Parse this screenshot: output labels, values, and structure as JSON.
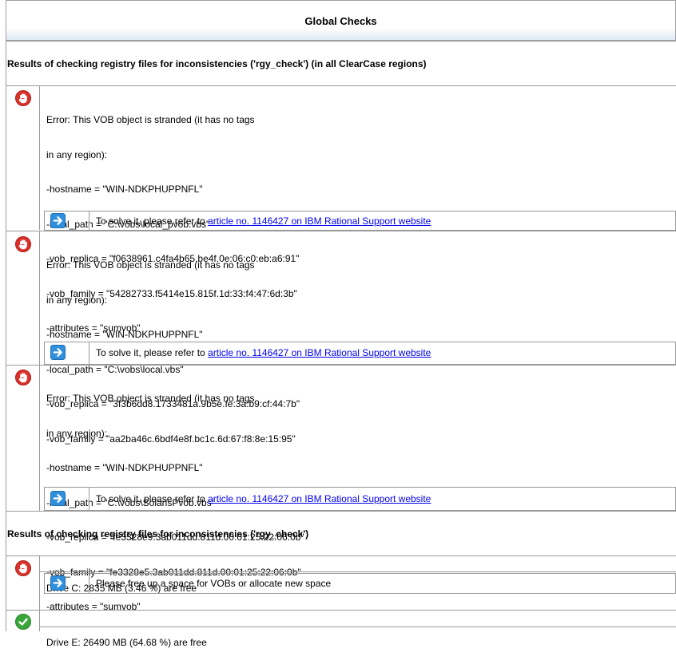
{
  "title": "Global Checks",
  "sections": [
    {
      "title": "Results of checking registry files for inconsistencies ('rgy_check') (in all ClearCase regions)",
      "entries": [
        {
          "status": "error",
          "lines": [
            "Error: This VOB object is stranded (it has no tags",
            "in any region):",
            "-hostname = \"WIN-NDKPHUPPNFL\"",
            "-local_path = \"C:\\vobs\\local_pvob.vbs\"",
            "-vob_replica = \"f0638961.c4fa4b65.be4f.0e:06:c0:eb:a6:91\"",
            "-vob_family = \"54282733.f5414e15.815f.1d:33:f4:47:6d:3b\"",
            "-attributes = \"sumvob\""
          ],
          "solution_prefix": "To solve it, please refer to ",
          "solution_link": "article no. 1146427 on IBM Rational Support website"
        },
        {
          "status": "error",
          "lines": [
            "Error: This VOB object is stranded (it has no tags",
            "in any region):",
            "-hostname = \"WIN-NDKPHUPPNFL\"",
            "-local_path = \"C:\\vobs\\local.vbs\"",
            "-vob_replica = \"3f3b6dd8.1733481a.9b5e.fe:3a:b9:cf:44:7b\"",
            "-vob_family = \"aa2ba46c.6bdf4e8f.bc1c.6d:67:f8:8e:15:95\""
          ],
          "solution_prefix": "To solve it, please refer to ",
          "solution_link": "article no. 1146427 on IBM Rational Support website"
        },
        {
          "status": "error",
          "lines": [
            "Error: This VOB object is stranded (it has no tags",
            "in any region):",
            "-hostname = \"WIN-NDKPHUPPNFL\"",
            "-local_path = \"C:\\vobs\\SolarisPvob.vbs\"",
            "-vob_replica = \"fe3328e9.3ab011dd.811d.00:01:25:22:06:0b\"",
            "-vob_family = \"fe3328e5.3ab011dd.811d.00:01:25:22:06:0b\"",
            "-attributes = \"sumvob\""
          ],
          "solution_prefix": "To solve it, please refer to ",
          "solution_link": "article no. 1146427 on IBM Rational Support website"
        }
      ]
    },
    {
      "title": "Results of checking registry files for inconsistencies ('rgy_check')",
      "entries": [
        {
          "status": "error",
          "lines": [
            "Drive C: 2835 MB (3.46 %) are free"
          ],
          "solution_prefix": "Please free up a space for VOBs or allocate new space",
          "solution_link": ""
        },
        {
          "status": "ok",
          "lines": [
            "Drive E: 26490 MB (64.68 %) are free"
          ]
        }
      ]
    }
  ],
  "icons": {
    "error": "stop-hand-icon",
    "ok": "check-icon",
    "solution": "arrow-right-icon"
  },
  "colors": {
    "error_red": "#d9322c",
    "ok_green": "#3aa63a",
    "solution_blue": "#2f8fdc",
    "link": "#0000ee"
  }
}
